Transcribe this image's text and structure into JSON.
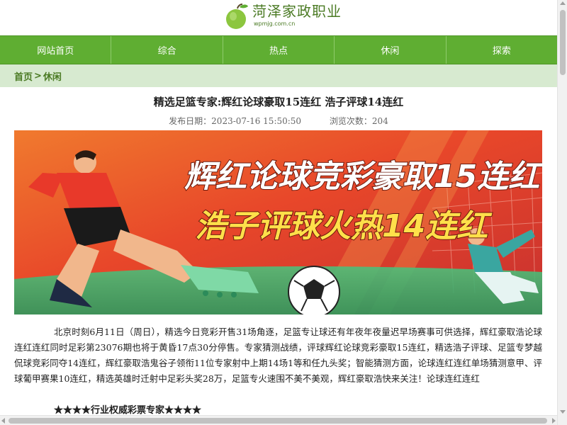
{
  "site": {
    "name": "菏泽家政职业",
    "url": "wpmjg.com.cn",
    "logo_icon": "green-fruit-icon"
  },
  "nav": {
    "items": [
      {
        "label": "网站首页"
      },
      {
        "label": "综合"
      },
      {
        "label": "热点"
      },
      {
        "label": "休闲"
      },
      {
        "label": "探索"
      }
    ]
  },
  "breadcrumb": {
    "home": "首页",
    "separator": ">",
    "current": "休闲"
  },
  "article": {
    "title": "精选足篮专家:辉红论球豪取15连红 浩子评球14连红",
    "publish_label": "发布日期：",
    "publish_date": "2023-07-16 15:50:50",
    "views_label": "浏览次数：",
    "views": "204",
    "banner": {
      "line1": "辉红论球竞彩豪取15连红",
      "line2": "浩子评球火热14连红"
    },
    "paragraph": "北京时刻6月11日（周日），精选今日竞彩开售31场角逐，足篮专让球还有年夜年夜量迟早场赛事可供选择，辉红豪取浩论球连红连红同时足彩第23076期也将于黄昏17点30分停售。专家猜测战绩，评球辉红论球竞彩豪取15连红，精选浩子评球、足篮专梦越侃球竞彩同夺14连红，辉红豪取浩鬼谷子领衔11位专家射中上期14场1等和任九头奖；智能猜测方面，论球连红连红单场猜测意甲、评球葡甲赛果10连红，精选英雄时迁射中足彩头奖28万，足篮专火速围不美不美观，辉红豪取浩快来关注！论球连红连红",
    "rating_line": "★★★★行业权威彩票专家★★★★"
  },
  "colors": {
    "brand_green": "#5fae32",
    "breadcrumb_bg": "#d7ead0",
    "logo_text": "#4a7a23",
    "banner_orange": "#e8472a",
    "banner_yellow": "#ffe04a"
  }
}
